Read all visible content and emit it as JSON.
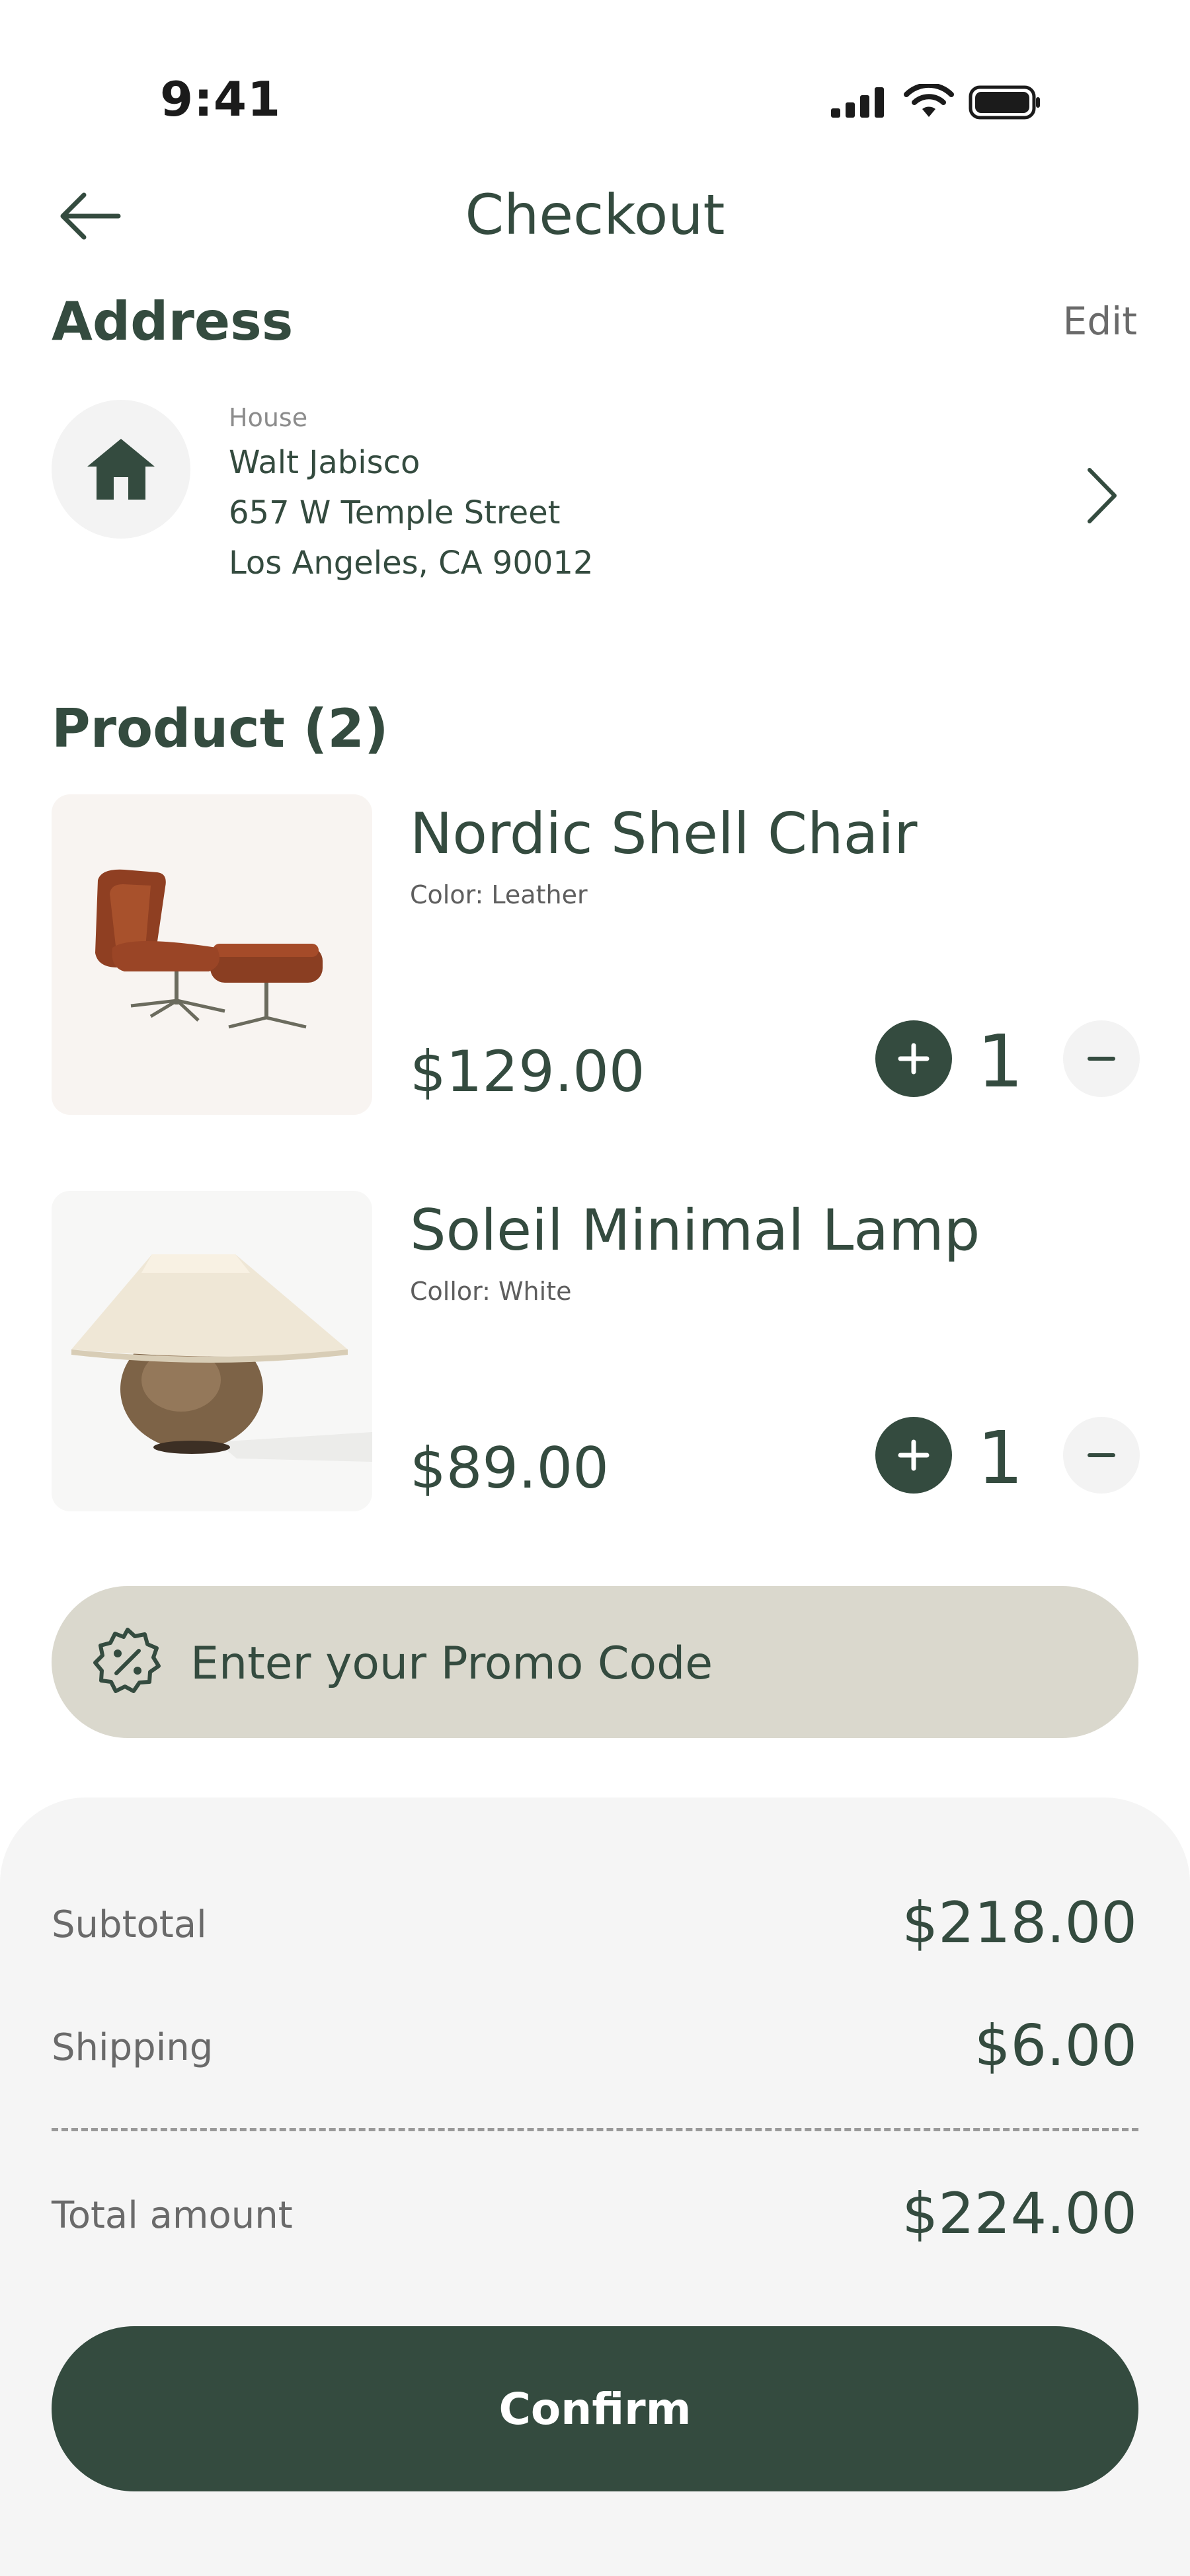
{
  "status_bar": {
    "time": "9:41",
    "icons": [
      "signal-icon",
      "wifi-icon",
      "battery-icon"
    ]
  },
  "header": {
    "title": "Checkout",
    "back_icon": "arrow-left-icon"
  },
  "address": {
    "section_title": "Address",
    "edit_label": "Edit",
    "type": "House",
    "name": "Walt Jabisco",
    "street": "657 W Temple Street",
    "city": "Los Angeles, CA 90012",
    "icon": "house-icon"
  },
  "products": {
    "section_title": "Product (2)",
    "items": [
      {
        "name": "Nordic Shell Chair",
        "color": "Color: Leather",
        "price": "$129.00",
        "quantity": "1"
      },
      {
        "name": "Soleil Minimal Lamp",
        "color": "Collor: White",
        "price": "$89.00",
        "quantity": "1"
      }
    ]
  },
  "promo": {
    "placeholder": "Enter your Promo Code",
    "icon": "discount-badge-icon"
  },
  "summary": {
    "subtotal_label": "Subtotal",
    "subtotal_value": "$218.00",
    "shipping_label": "Shipping",
    "shipping_value": "$6.00",
    "total_label": "Total amount",
    "total_value": "$224.00"
  },
  "confirm_label": "Confirm",
  "colors": {
    "primary": "#344b3f",
    "promo_bg": "#dad8cd",
    "summary_bg": "#f5f5f5",
    "muted_text": "#6a6a6a"
  }
}
